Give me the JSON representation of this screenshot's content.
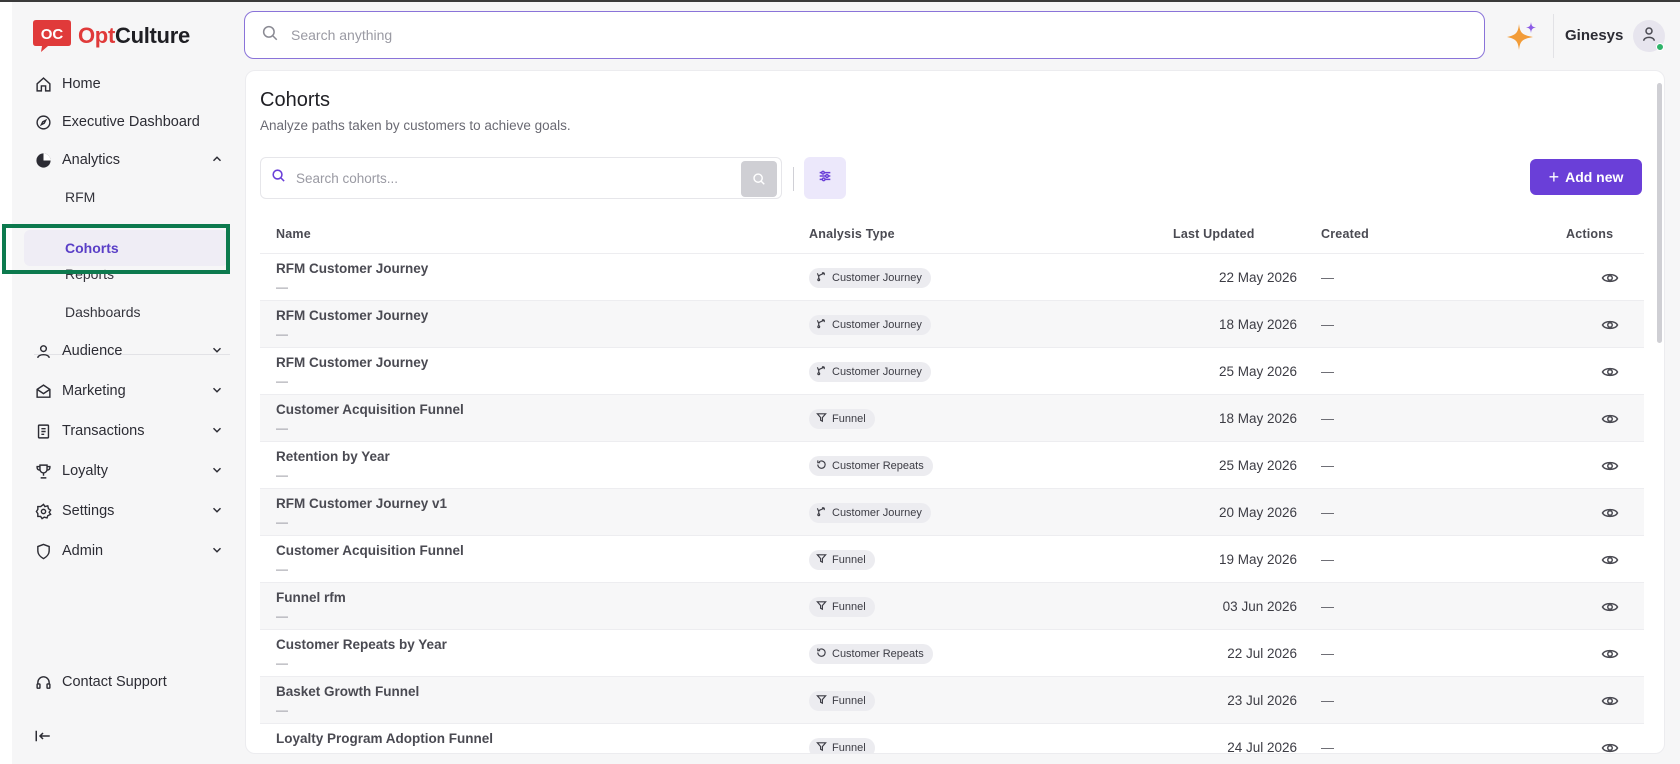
{
  "brand": {
    "opt": "Opt",
    "culture": "Culture",
    "mark": "OC"
  },
  "topbar": {
    "search_placeholder": "Search anything",
    "org_name": "Ginesys"
  },
  "sidebar": {
    "items": [
      {
        "label": "Home",
        "icon": "home-icon"
      },
      {
        "label": "Executive Dashboard",
        "icon": "compass-icon"
      },
      {
        "label": "Analytics",
        "icon": "pie-chart-icon",
        "expanded": true,
        "children": [
          {
            "label": "RFM"
          },
          {
            "label": "Cohorts",
            "active": true
          },
          {
            "label": "Reports"
          },
          {
            "label": "Dashboards"
          }
        ]
      },
      {
        "label": "Audience",
        "icon": "user-icon"
      },
      {
        "label": "Marketing",
        "icon": "envelope-icon"
      },
      {
        "label": "Transactions",
        "icon": "receipt-icon"
      },
      {
        "label": "Loyalty",
        "icon": "trophy-icon"
      },
      {
        "label": "Settings",
        "icon": "gear-icon"
      },
      {
        "label": "Admin",
        "icon": "shield-icon"
      }
    ],
    "support_label": "Contact Support"
  },
  "page": {
    "title": "Cohorts",
    "subtitle": "Analyze paths taken by customers to achieve goals.",
    "search_placeholder": "Search cohorts...",
    "add_label": "Add new"
  },
  "table": {
    "columns": {
      "name": "Name",
      "type": "Analysis Type",
      "updated": "Last Updated",
      "created": "Created",
      "actions": "Actions"
    },
    "rows": [
      {
        "name": "RFM Customer Journey",
        "sub": "—",
        "type": "Customer Journey",
        "type_icon": "branch-icon",
        "updated": "22 May 2026",
        "created": "—"
      },
      {
        "name": "RFM Customer Journey",
        "sub": "—",
        "type": "Customer Journey",
        "type_icon": "branch-icon",
        "updated": "18 May 2026",
        "created": "—"
      },
      {
        "name": "RFM Customer Journey",
        "sub": "—",
        "type": "Customer Journey",
        "type_icon": "branch-icon",
        "updated": "25 May 2026",
        "created": "—"
      },
      {
        "name": "Customer Acquisition Funnel",
        "sub": "—",
        "type": "Funnel",
        "type_icon": "funnel-icon",
        "updated": "18 May 2026",
        "created": "—"
      },
      {
        "name": "Retention by Year",
        "sub": "—",
        "type": "Customer Repeats",
        "type_icon": "repeat-icon",
        "updated": "25 May 2026",
        "created": "—"
      },
      {
        "name": "RFM Customer Journey v1",
        "sub": "—",
        "type": "Customer Journey",
        "type_icon": "branch-icon",
        "updated": "20 May 2026",
        "created": "—"
      },
      {
        "name": "Customer Acquisition Funnel",
        "sub": "—",
        "type": "Funnel",
        "type_icon": "funnel-icon",
        "updated": "19 May 2026",
        "created": "—"
      },
      {
        "name": "Funnel rfm",
        "sub": "—",
        "type": "Funnel",
        "type_icon": "funnel-icon",
        "updated": "03 Jun 2026",
        "created": "—"
      },
      {
        "name": "Customer Repeats by Year",
        "sub": "—",
        "type": "Customer Repeats",
        "type_icon": "repeat-icon",
        "updated": "22 Jul 2026",
        "created": "—"
      },
      {
        "name": "Basket Growth Funnel",
        "sub": "—",
        "type": "Funnel",
        "type_icon": "funnel-icon",
        "updated": "23 Jul 2026",
        "created": "—"
      },
      {
        "name": "Loyalty Program Adoption Funnel",
        "sub": "",
        "type": "Funnel",
        "type_icon": "funnel-icon",
        "updated": "24 Jul 2026",
        "created": "—"
      }
    ]
  },
  "colors": {
    "accent": "#6a3fd8",
    "brand_red": "#e03a3a",
    "highlight": "#0d7a4e"
  }
}
